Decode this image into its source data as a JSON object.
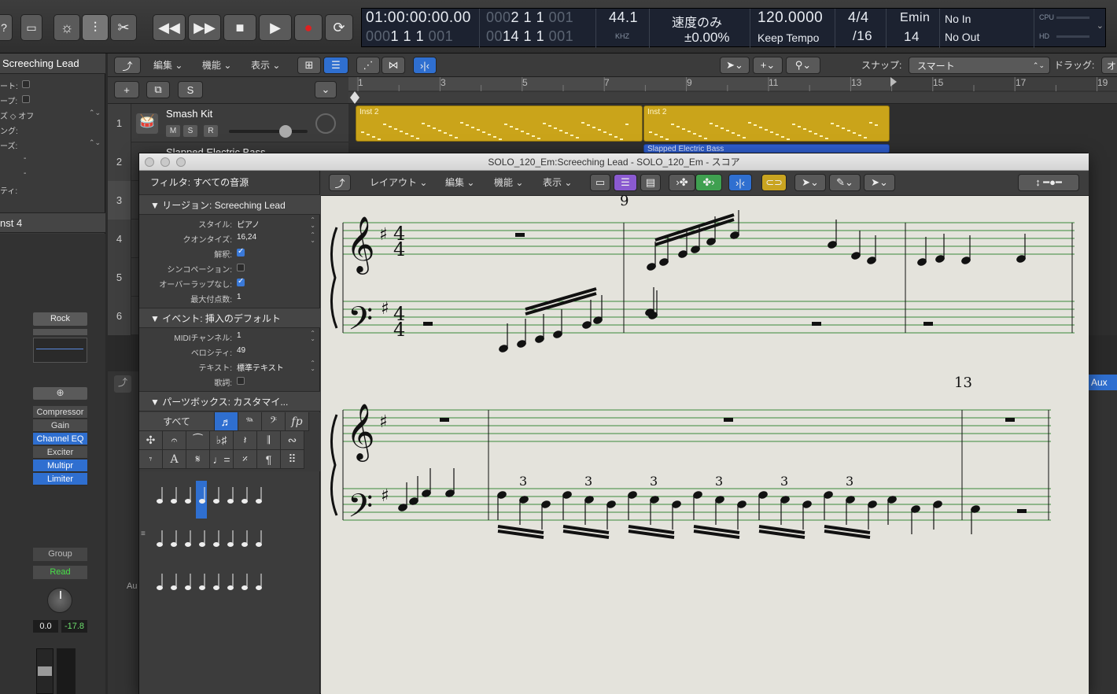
{
  "transport": {
    "position_main": "01:00:00:00.00",
    "position_sub_prefix": "000",
    "position_sub": "1  1  1",
    "position_sub_suffix": "001",
    "bars_main_prefix": "000",
    "bars_main": "2  1  1",
    "bars_main_suffix": "001",
    "bars_sub_prefix": "00",
    "bars_sub": "14  1  1",
    "bars_sub_suffix": "001",
    "sample_rate": "44.1",
    "sample_unit": "KHZ",
    "tempo_mode": "速度のみ",
    "tempo_offset": "±0.00%",
    "tempo": "120.0000",
    "tempo_label": "Keep Tempo",
    "time_sig": "4/4",
    "division": "/16",
    "key": "Emin",
    "key_num": "14",
    "midi_in": "No In",
    "midi_out": "No Out",
    "cpu_label": "CPU",
    "hd_label": "HD"
  },
  "inspector": {
    "title": "Screeching Lead",
    "rows": [
      "ート:",
      "ープ:",
      "ズ ◇ オフ",
      "ング:",
      "ーズ:",
      "-",
      "-",
      "ティ:"
    ],
    "inst_label": "nst 4",
    "preset": "Rock",
    "plugins": [
      "Compressor",
      "Gain",
      "Channel EQ",
      "Exciter",
      "Multipr",
      "Limiter"
    ],
    "group": "Group",
    "automation": "Read",
    "vol_val": "0.0",
    "peak_val": "-17.8",
    "aux_label": "Au"
  },
  "tracks_menu": {
    "edit": "編集",
    "functions": "機能",
    "view": "表示",
    "snap_label": "スナップ:",
    "snap_value": "スマート",
    "drag_label": "ドラッグ:",
    "drag_value": "オ"
  },
  "ruler": [
    "1",
    "3",
    "5",
    "7",
    "9",
    "11",
    "13",
    "15",
    "17",
    "19"
  ],
  "tracks": [
    {
      "num": "1",
      "name": "Smash Kit"
    },
    {
      "num": "2",
      "name": "Slapped Electric Bass"
    },
    {
      "num": "3",
      "name": ""
    },
    {
      "num": "4",
      "name": ""
    },
    {
      "num": "5",
      "name": ""
    },
    {
      "num": "6",
      "name": ""
    }
  ],
  "regions": [
    {
      "label": "Inst 2"
    },
    {
      "label": "Inst 2"
    },
    {
      "label": "Slapped Electric Bass"
    }
  ],
  "aux_label": "Aux",
  "score": {
    "title": "SOLO_120_Em:Screeching Lead - SOLO_120_Em - スコア",
    "filter_label": "フィルタ:",
    "filter_value": "すべての音源",
    "region_section": "リージョン:",
    "region_name": "Screeching Lead",
    "region_props": [
      {
        "label": "スタイル:",
        "value": "ピアノ"
      },
      {
        "label": "クオンタイズ:",
        "value": "16,24"
      },
      {
        "label": "解釈:",
        "value": ""
      },
      {
        "label": "シンコペーション:",
        "value": ""
      },
      {
        "label": "オーバーラップなし:",
        "value": ""
      },
      {
        "label": "最大付点数:",
        "value": "1"
      }
    ],
    "event_section": "イベント:",
    "event_name": "挿入のデフォルト",
    "event_props": [
      {
        "label": "MIDIチャンネル:",
        "value": "1"
      },
      {
        "label": "ベロシティ:",
        "value": "49"
      },
      {
        "label": "テキスト:",
        "value": "標準テキスト"
      },
      {
        "label": "歌詞:",
        "value": ""
      }
    ],
    "parts_section": "パーツボックス:",
    "parts_name": "カスタマイ...",
    "parts_all": "すべて",
    "toolbar": {
      "layout": "レイアウト",
      "edit": "編集",
      "functions": "機能",
      "view": "表示"
    },
    "measure_numbers": [
      "9",
      "13"
    ]
  }
}
